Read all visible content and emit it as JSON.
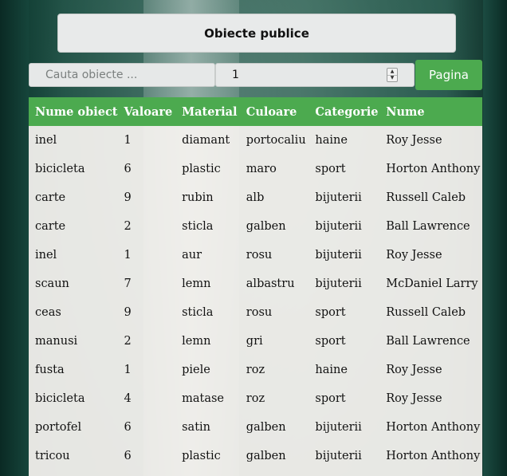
{
  "header": {
    "title_button": "Obiecte publice"
  },
  "controls": {
    "search_placeholder": "Cauta obiecte ...",
    "search_value": "",
    "page_value": "1",
    "page_button": "Pagina"
  },
  "colors": {
    "accent": "#4caa4f",
    "background": "#0e3b33"
  },
  "icons": {
    "spinner_up": "triangle-up",
    "spinner_down": "triangle-down"
  },
  "table": {
    "headers": [
      "Nume obiect",
      "Valoare",
      "Material",
      "Culoare",
      "Categorie",
      "Nume"
    ],
    "rows": [
      [
        "inel",
        "1",
        "diamant",
        "portocaliu",
        "haine",
        "Roy Jesse"
      ],
      [
        "bicicleta",
        "6",
        "plastic",
        "maro",
        "sport",
        "Horton Anthony"
      ],
      [
        "carte",
        "9",
        "rubin",
        "alb",
        "bijuterii",
        "Russell Caleb"
      ],
      [
        "carte",
        "2",
        "sticla",
        "galben",
        "bijuterii",
        "Ball Lawrence"
      ],
      [
        "inel",
        "1",
        "aur",
        "rosu",
        "bijuterii",
        "Roy Jesse"
      ],
      [
        "scaun",
        "7",
        "lemn",
        "albastru",
        "bijuterii",
        "McDaniel Larry"
      ],
      [
        "ceas",
        "9",
        "sticla",
        "rosu",
        "sport",
        "Russell Caleb"
      ],
      [
        "manusi",
        "2",
        "lemn",
        "gri",
        "sport",
        "Ball Lawrence"
      ],
      [
        "fusta",
        "1",
        "piele",
        "roz",
        "haine",
        "Roy Jesse"
      ],
      [
        "bicicleta",
        "4",
        "matase",
        "roz",
        "sport",
        "Roy Jesse"
      ],
      [
        "portofel",
        "6",
        "satin",
        "galben",
        "bijuterii",
        "Horton Anthony"
      ],
      [
        "tricou",
        "6",
        "plastic",
        "galben",
        "bijuterii",
        "Horton Anthony"
      ]
    ]
  }
}
